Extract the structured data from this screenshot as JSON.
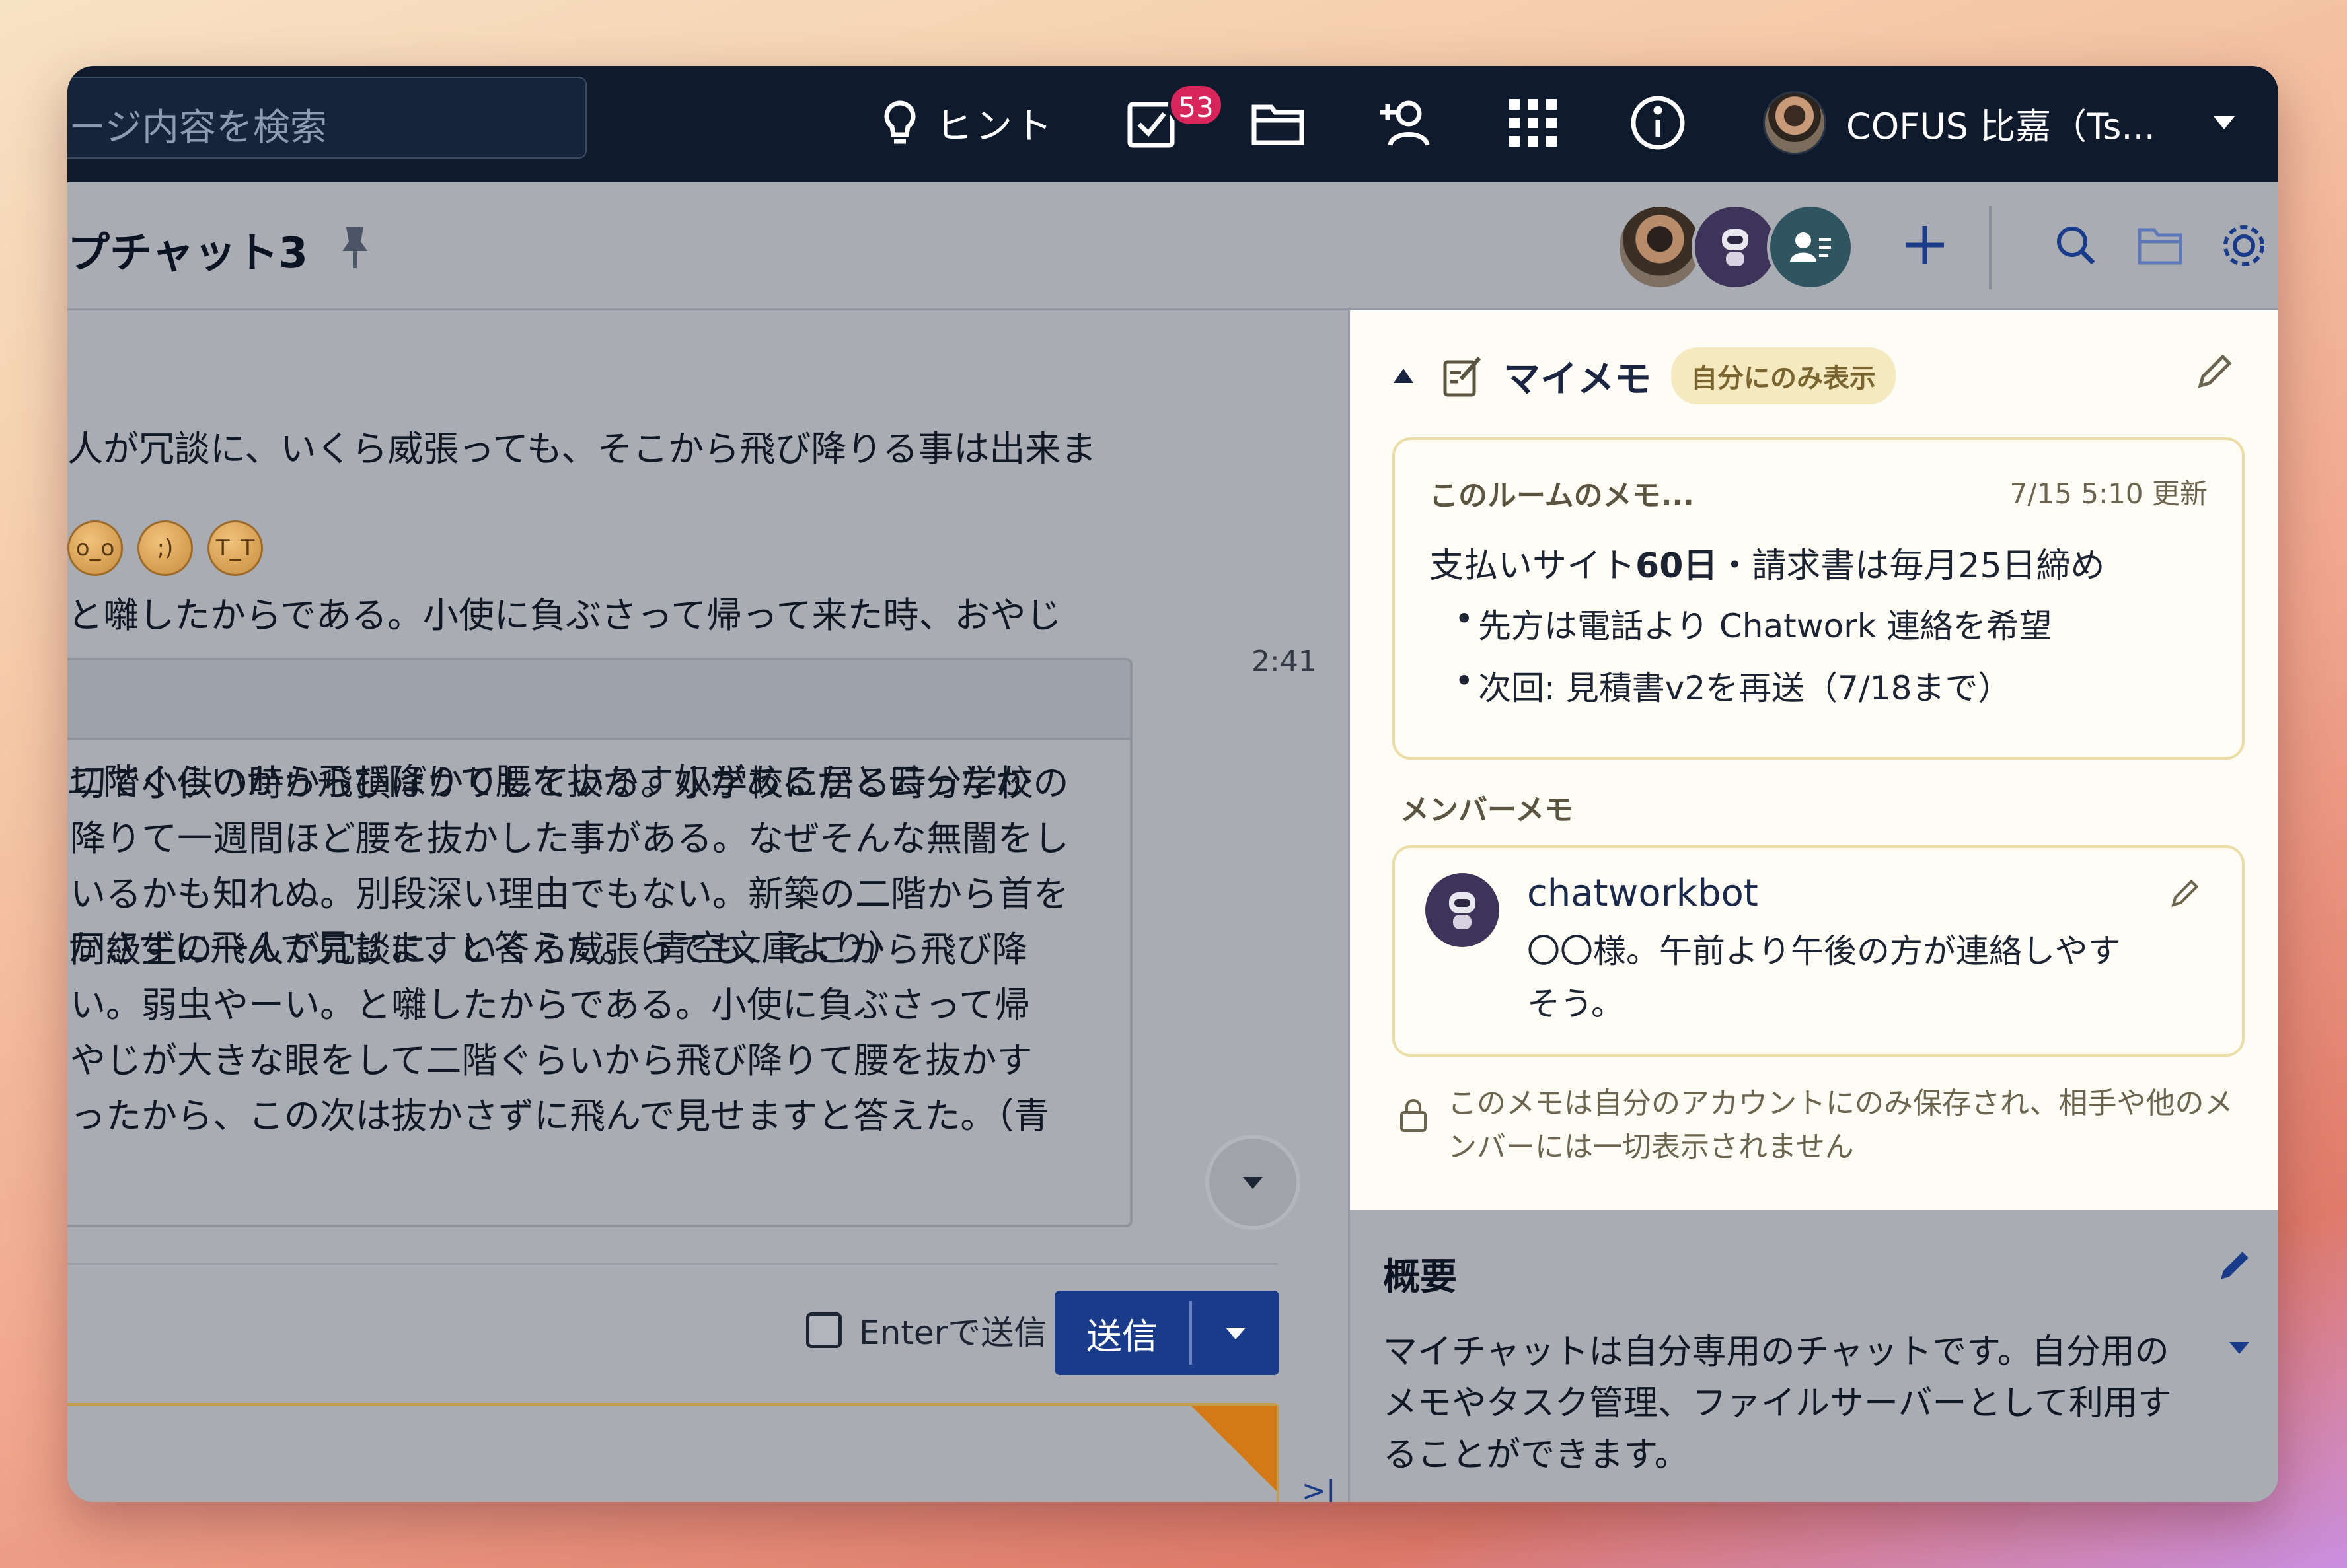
{
  "topbar": {
    "search_placeholder": "ージ内容を検索",
    "hint_label": "ヒント",
    "task_badge": "53",
    "user_name": "COFUS 比嘉（Ts..."
  },
  "room": {
    "title": "プチャット3"
  },
  "chat": {
    "message_lines": [
      "人が冗談に、いくら威張っても、そこから飛び降りる事は出来ま",
      "と囃したからである。小使に負ぶさって帰って来た時、おやじ",
      "二階ぐらいから飛び降りて腰を抜かす奴があるかと云ったか",
      "かさずに飛んで見せますと答えた。（青空文庫より）"
    ],
    "timestamp": "2:41",
    "quote_lines": [
      "切で小供の時から損ばかりしている。小学校に居る時分学校の",
      "降りて一週間ほど腰を抜かした事がある。なぜそんな無闇をし",
      "いるかも知れぬ。別段深い理由でもない。新築の二階から首を",
      "同級生の一人が冗談に、いくら威張っても、そこから飛び降",
      "い。弱虫やーい。と囃したからである。小使に負ぶさって帰",
      "やじが大きな眼をして二階ぐらいから飛び降りて腰を抜かす",
      "ったから、この次は抜かさずに飛んで見せますと答えた。（青"
    ],
    "enter_to_send": "Enterで送信",
    "send_label": "送信",
    "collapse_label": ">|"
  },
  "memo": {
    "title": "マイメモ",
    "self_only_badge": "自分にのみ表示",
    "room_memo": {
      "title": "このルームのメモ...",
      "updated": "7/15 5:10 更新",
      "line_prefix": "支払いサイト",
      "line_bold": "60日",
      "line_suffix": "・請求書は毎月25日締め",
      "bullets": [
        "先方は電話より Chatwork 連絡を希望",
        "次回: 見積書v2を再送（7/18まで）"
      ]
    },
    "member_memo_label": "メンバーメモ",
    "member_memo": {
      "name": "chatworkbot",
      "text": "〇〇様。午前より午後の方が連絡しやすそう。"
    },
    "privacy_note": "このメモは自分のアカウントにのみ保存され、相手や他のメンバーには一切表示されません"
  },
  "summary": {
    "title": "概要",
    "text": "マイチャットは自分専用のチャットです。自分用のメモやタスク管理、ファイルサーバーとして利用することができます。"
  },
  "icons": {
    "hint": "lightbulb-icon",
    "tasks": "task-check-icon",
    "files": "folder-icon",
    "contacts": "add-contact-icon",
    "apps": "grid-icon",
    "info": "info-icon",
    "pin": "pin-icon",
    "memo": "memo-edit-icon",
    "lock": "lock-icon"
  },
  "colors": {
    "topbar": "#0f1a2d",
    "badge": "#d8265b",
    "send_button": "#1a3a8a",
    "memo_background": "#fdfcf5",
    "memo_border": "#ecdca6"
  }
}
